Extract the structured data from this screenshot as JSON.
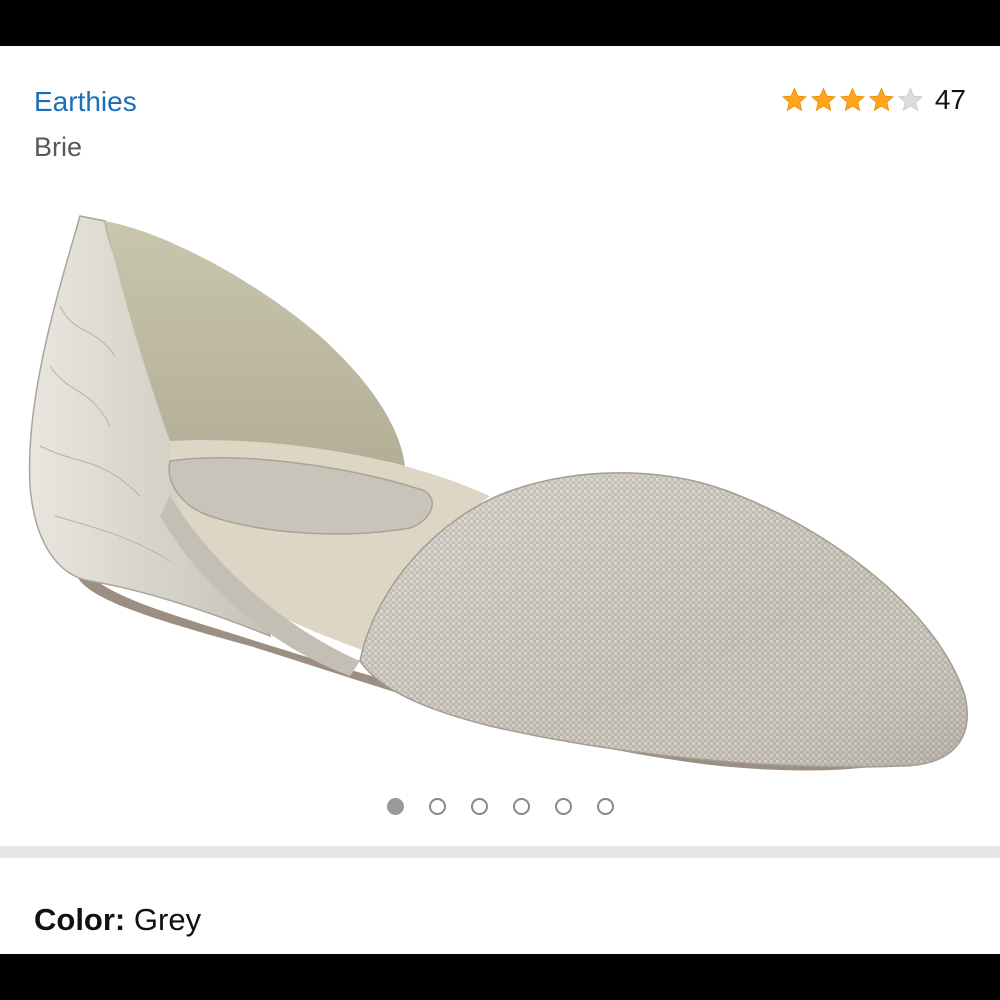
{
  "product": {
    "brand": "Earthies",
    "name": "Brie",
    "rating_value": 4,
    "rating_max": 5,
    "rating_count": "47",
    "image_alt": "Grey metallic d'Orsay flat shoe"
  },
  "carousel": {
    "total": 6,
    "active_index": 0
  },
  "color": {
    "label": "Color:",
    "value": "Grey"
  },
  "colors": {
    "link": "#1a6fb5",
    "star_filled": "#ffa41c",
    "star_empty": "#dcdcdc",
    "separator": "#e7e7e7"
  }
}
